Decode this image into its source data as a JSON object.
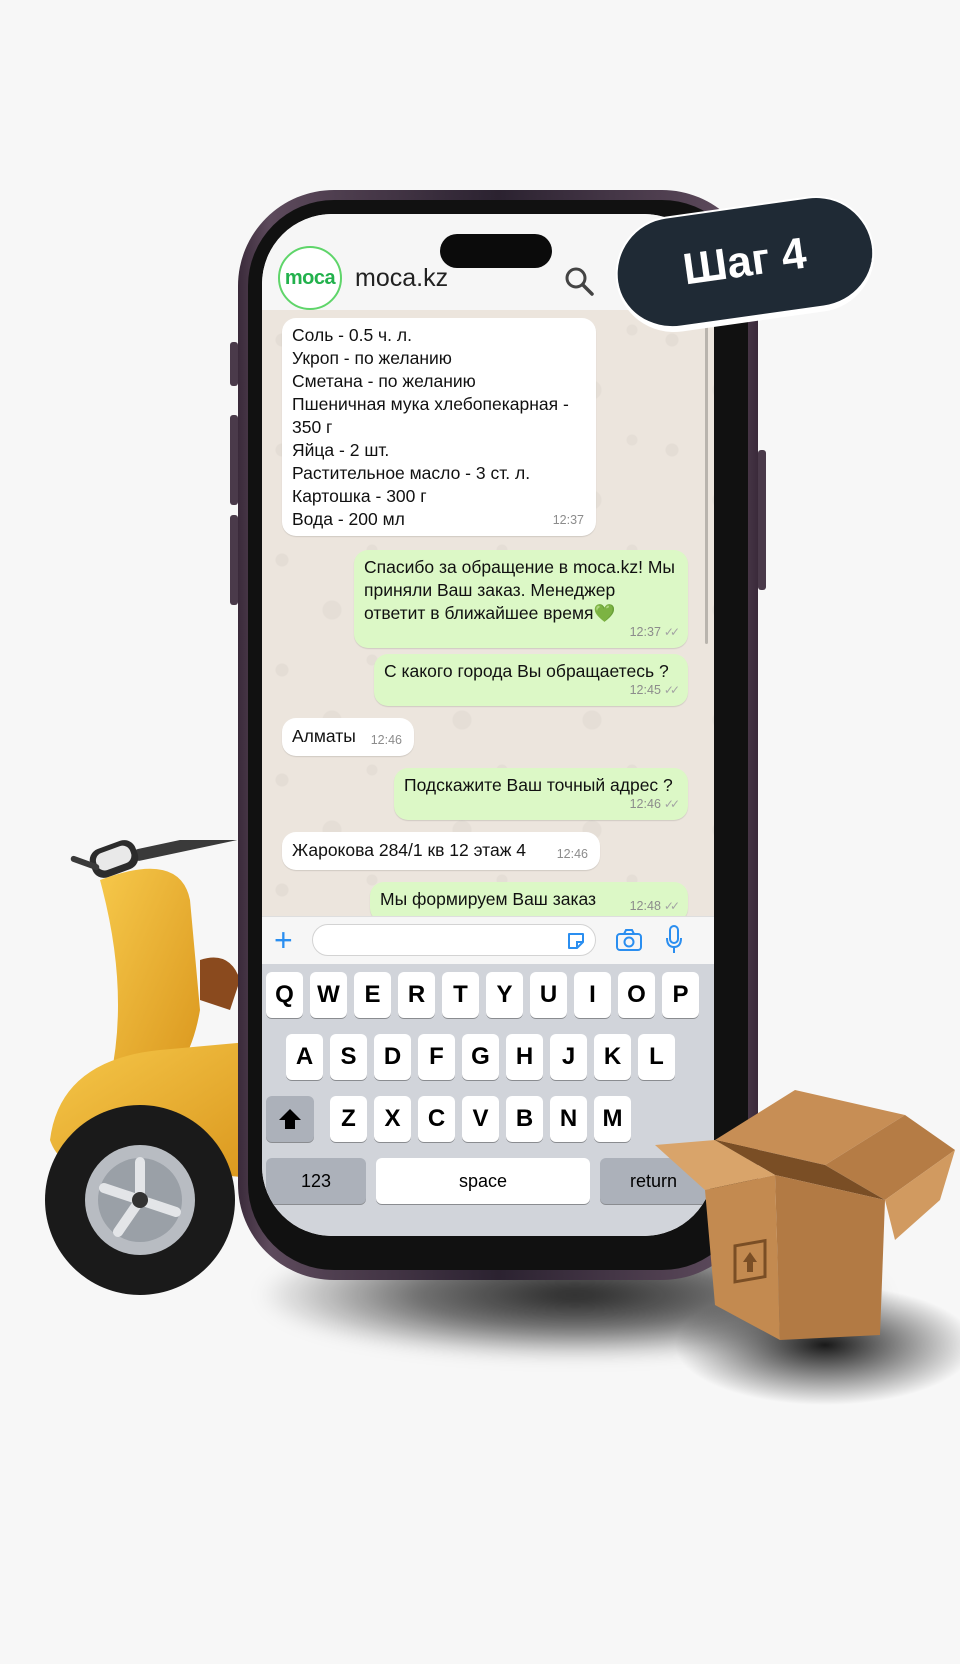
{
  "step_badge": "Шаг 4",
  "header": {
    "avatar_text": "moca",
    "contact_name": "moca.kz",
    "search_icon": "search-icon"
  },
  "messages": [
    {
      "direction": "incoming",
      "lines": [
        "Соль - 0.5 ч. л.",
        "Укроп -  по желанию",
        "Сметана -  по желанию",
        "Пшеничная мука хлебопекарная -",
        "350 г",
        "Яйца - 2 шт.",
        "Растительное масло - 3 ст. л.",
        "Картошка - 300 г",
        "Вода - 200 мл"
      ],
      "time": "12:37"
    },
    {
      "direction": "outgoing",
      "lines": [
        "Спасибо за обращение в moca.kz! Мы",
        "приняли Ваш заказ. Менеджер",
        "ответит в ближайшее время"
      ],
      "emoji": "💚",
      "time": "12:37"
    },
    {
      "direction": "outgoing",
      "lines": [
        "С какого города Вы обращаетесь ?"
      ],
      "time": "12:45"
    },
    {
      "direction": "incoming",
      "lines": [
        "Алматы"
      ],
      "time": "12:46"
    },
    {
      "direction": "outgoing",
      "lines": [
        "Подскажите Ваш точный адрес ?"
      ],
      "time": "12:46"
    },
    {
      "direction": "incoming",
      "lines": [
        "Жарокова 284/1 кв 12 этаж 4"
      ],
      "time": "12:46"
    },
    {
      "direction": "outgoing",
      "lines": [
        "Мы формируем Ваш заказ"
      ],
      "time": "12:48"
    }
  ],
  "input_bar": {
    "placeholder": "",
    "icons": [
      "plus-icon",
      "sticker-icon",
      "camera-icon",
      "microphone-icon"
    ]
  },
  "keyboard": {
    "row1": [
      "Q",
      "W",
      "E",
      "R",
      "T",
      "Y",
      "U",
      "I",
      "O",
      "P"
    ],
    "row2": [
      "A",
      "S",
      "D",
      "F",
      "G",
      "H",
      "J",
      "K",
      "L"
    ],
    "row3": [
      "Z",
      "X",
      "C",
      "V",
      "B",
      "N",
      "M"
    ],
    "numbers_label": "123",
    "space_label": "space",
    "return_label": "return"
  },
  "colors": {
    "outgoing_bubble": "#dcf8c6",
    "incoming_bubble": "#ffffff",
    "chat_background": "#ece5dd",
    "badge_background": "#1f2a35",
    "brand_green": "#22b14c",
    "accent_blue": "#2a8ef0"
  }
}
